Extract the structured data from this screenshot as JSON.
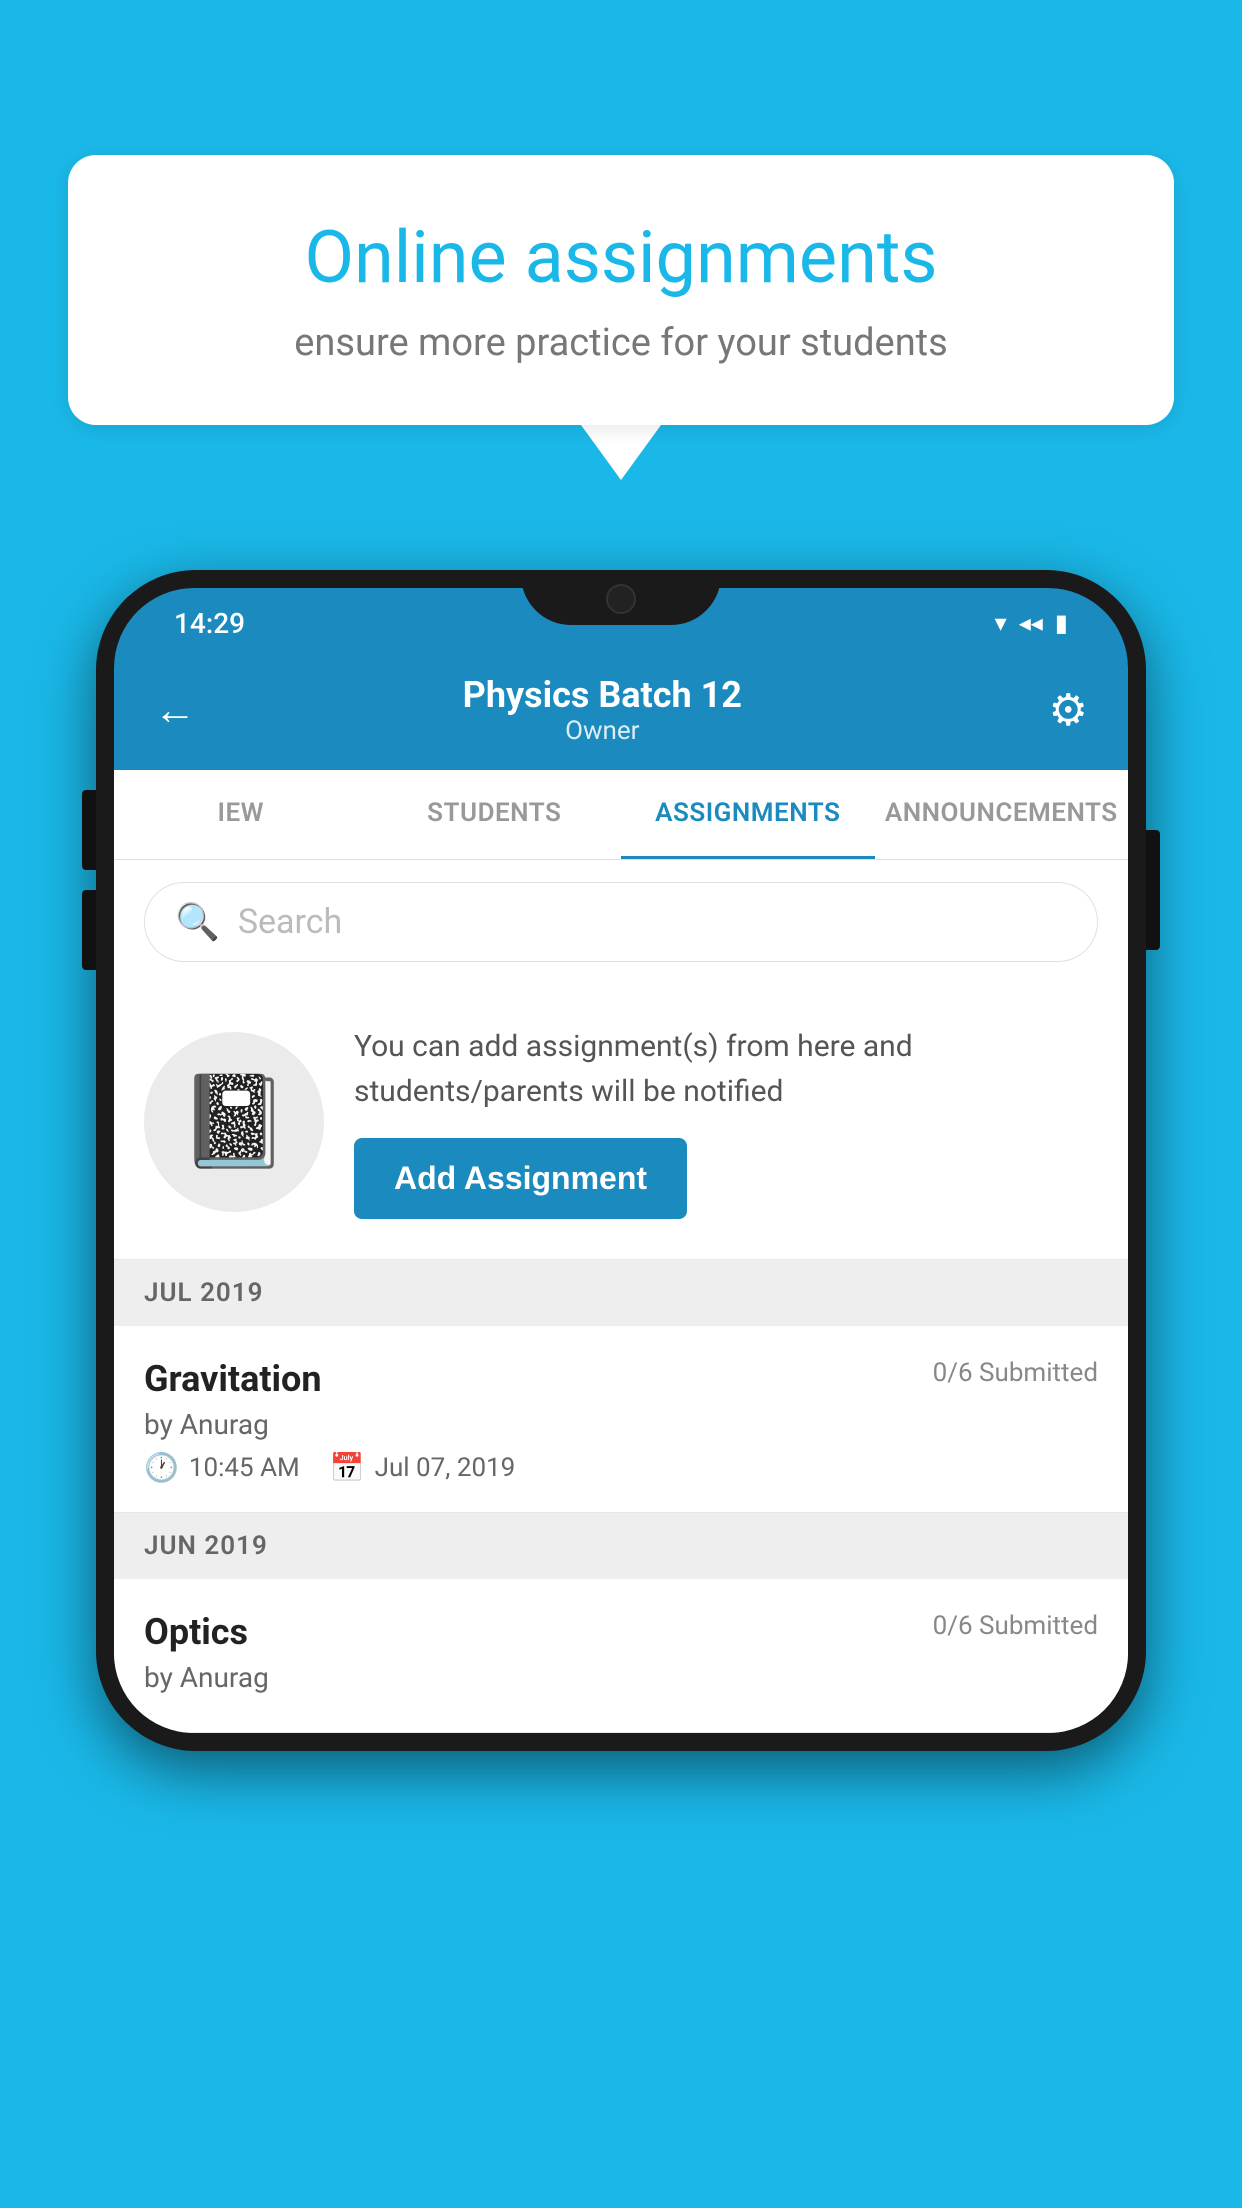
{
  "background_color": "#1ab8e8",
  "speech_bubble": {
    "title": "Online assignments",
    "subtitle": "ensure more practice for your students"
  },
  "phone": {
    "status_bar": {
      "time": "14:29",
      "icons": [
        "wifi",
        "signal",
        "battery"
      ]
    },
    "app_bar": {
      "title": "Physics Batch 12",
      "subtitle": "Owner",
      "back_label": "←",
      "settings_label": "⚙"
    },
    "tabs": [
      {
        "label": "IEW",
        "active": false
      },
      {
        "label": "STUDENTS",
        "active": false
      },
      {
        "label": "ASSIGNMENTS",
        "active": true
      },
      {
        "label": "ANNOUNCEMENTS",
        "active": false
      }
    ],
    "search": {
      "placeholder": "Search"
    },
    "add_assignment_card": {
      "description": "You can add assignment(s) from here and students/parents will be notified",
      "button_label": "Add Assignment"
    },
    "sections": [
      {
        "header": "JUL 2019",
        "assignments": [
          {
            "name": "Gravitation",
            "submitted": "0/6 Submitted",
            "author": "by Anurag",
            "time": "10:45 AM",
            "date": "Jul 07, 2019"
          }
        ]
      },
      {
        "header": "JUN 2019",
        "assignments": [
          {
            "name": "Optics",
            "submitted": "0/6 Submitted",
            "author": "by Anurag",
            "time": "",
            "date": ""
          }
        ]
      }
    ]
  }
}
